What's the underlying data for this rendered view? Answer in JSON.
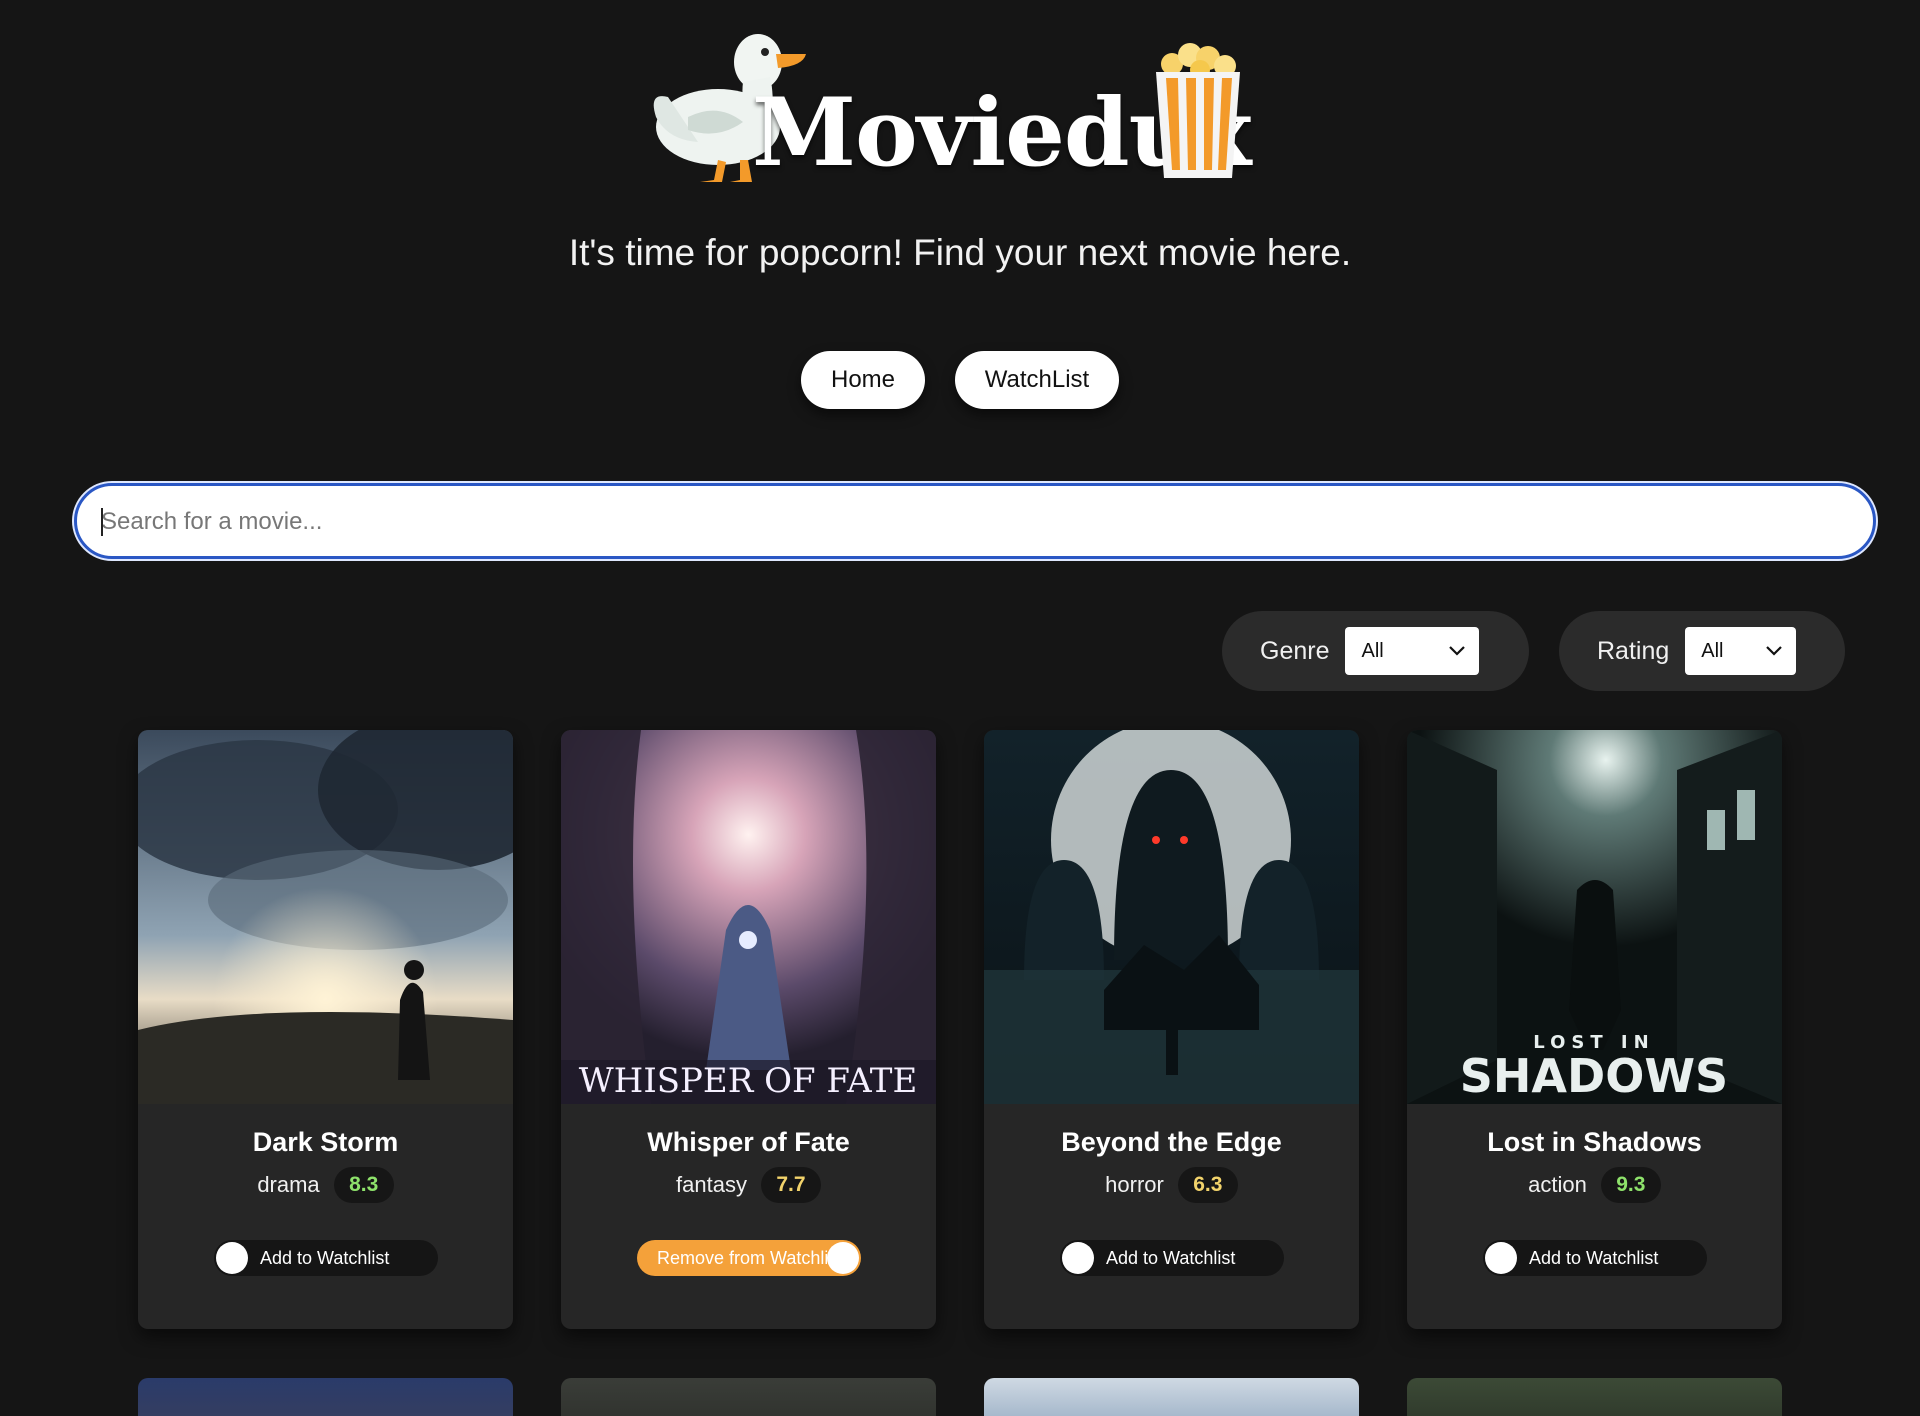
{
  "header": {
    "brand": "Moviedux",
    "logo_icons": [
      "duck-icon",
      "popcorn-bucket-icon"
    ],
    "tagline": "It's time for popcorn! Find your next movie here."
  },
  "nav": {
    "home_label": "Home",
    "watchlist_label": "WatchList"
  },
  "search": {
    "placeholder": "Search for a movie...",
    "value": ""
  },
  "filters": {
    "genre_label": "Genre",
    "genre_selected": "All",
    "rating_label": "Rating",
    "rating_selected": "All"
  },
  "movies": [
    {
      "title": "Dark Storm",
      "genre": "drama",
      "rating": "8.3",
      "rating_color": "#8ee26b",
      "watchlist_label": "Add to Watchlist",
      "in_watchlist": false,
      "poster_text": ""
    },
    {
      "title": "Whisper of Fate",
      "genre": "fantasy",
      "rating": "7.7",
      "rating_color": "#f2d36b",
      "watchlist_label": "Remove from Watchlist",
      "in_watchlist": true,
      "poster_text": "WHISPER OF FATE"
    },
    {
      "title": "Beyond the Edge",
      "genre": "horror",
      "rating": "6.3",
      "rating_color": "#f2d36b",
      "watchlist_label": "Add to Watchlist",
      "in_watchlist": false,
      "poster_text": ""
    },
    {
      "title": "Lost in Shadows",
      "genre": "action",
      "rating": "9.3",
      "rating_color": "#8ee26b",
      "watchlist_label": "Add to Watchlist",
      "in_watchlist": false,
      "poster_text": "LOST IN SHADOWS"
    }
  ],
  "colors": {
    "background": "#151515",
    "card": "#262626",
    "accent_orange": "#f4a13a",
    "search_border": "#2a57c4"
  }
}
